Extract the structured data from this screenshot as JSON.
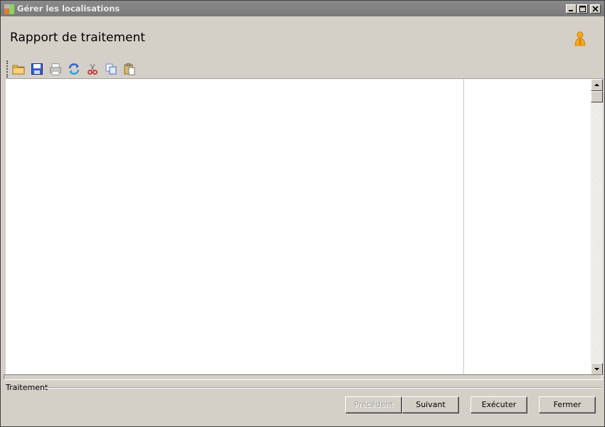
{
  "window": {
    "title": "Gérer les localisations",
    "controls": [
      "minimize-icon",
      "maximize-icon",
      "close-icon"
    ]
  },
  "header": {
    "title": "Rapport de traitement",
    "icon": "user-icon"
  },
  "toolbar": {
    "buttons": [
      {
        "name": "open-folder-icon"
      },
      {
        "name": "save-icon"
      },
      {
        "name": "print-icon",
        "disabled": true
      },
      {
        "name": "refresh-icon"
      },
      {
        "name": "cut-icon"
      },
      {
        "name": "copy-icon"
      },
      {
        "name": "paste-icon"
      }
    ]
  },
  "group": {
    "label": "Traitement"
  },
  "footer": {
    "previous_label": "Précédent",
    "next_label": "Suivant",
    "execute_label": "Exécuter",
    "close_label": "Fermer"
  },
  "colors": {
    "titlebar": "#7f7f7f",
    "face": "#d4d0c8",
    "content": "#ffffff"
  }
}
